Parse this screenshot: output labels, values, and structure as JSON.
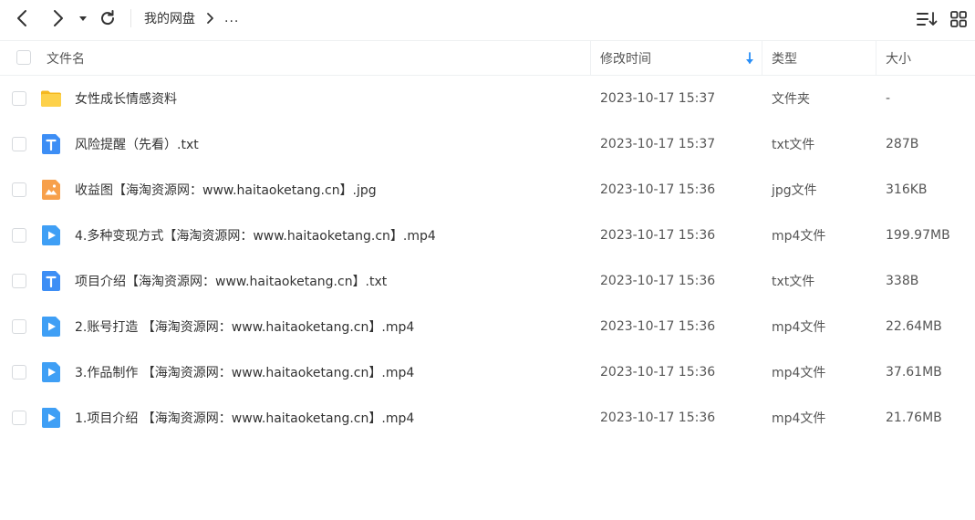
{
  "toolbar": {
    "back_icon": "chevron-left-icon",
    "forward_icon": "chevron-right-icon",
    "history_icon": "caret-down-icon",
    "refresh_icon": "refresh-icon",
    "breadcrumb": {
      "home": "我的网盘",
      "separator_icon": "chevron-right-icon",
      "more": "..."
    },
    "sort_icon": "sort-list-icon",
    "view_icon": "grid-view-icon"
  },
  "columns": {
    "name": "文件名",
    "modified": "修改时间",
    "type": "类型",
    "size": "大小",
    "sort_indicator_icon": "arrow-down-icon"
  },
  "files": [
    {
      "name": "女性成长情感资料",
      "modified": "2023-10-17 15:37",
      "type": "文件夹",
      "size": "-",
      "icon": "folder-icon"
    },
    {
      "name": "风险提醒（先看）.txt",
      "modified": "2023-10-17 15:37",
      "type": "txt文件",
      "size": "287B",
      "icon": "text-file-icon"
    },
    {
      "name": "收益图【海淘资源网：www.haitaoketang.cn】.jpg",
      "modified": "2023-10-17 15:36",
      "type": "jpg文件",
      "size": "316KB",
      "icon": "image-file-icon"
    },
    {
      "name": "4.多种变现方式【海淘资源网：www.haitaoketang.cn】.mp4",
      "modified": "2023-10-17 15:36",
      "type": "mp4文件",
      "size": "199.97MB",
      "icon": "video-file-icon"
    },
    {
      "name": "项目介绍【海淘资源网：www.haitaoketang.cn】.txt",
      "modified": "2023-10-17 15:36",
      "type": "txt文件",
      "size": "338B",
      "icon": "text-file-icon"
    },
    {
      "name": "2.账号打造 【海淘资源网：www.haitaoketang.cn】.mp4",
      "modified": "2023-10-17 15:36",
      "type": "mp4文件",
      "size": "22.64MB",
      "icon": "video-file-icon"
    },
    {
      "name": "3.作品制作 【海淘资源网：www.haitaoketang.cn】.mp4",
      "modified": "2023-10-17 15:36",
      "type": "mp4文件",
      "size": "37.61MB",
      "icon": "video-file-icon"
    },
    {
      "name": "1.项目介绍 【海淘资源网：www.haitaoketang.cn】.mp4",
      "modified": "2023-10-17 15:36",
      "type": "mp4文件",
      "size": "21.76MB",
      "icon": "video-file-icon"
    }
  ],
  "colors": {
    "accent": "#2a8ff7",
    "folder": "#fbc932",
    "text_file": "#3d8ef5",
    "image_file": "#f7a04b",
    "video_file": "#3f9ff5"
  }
}
